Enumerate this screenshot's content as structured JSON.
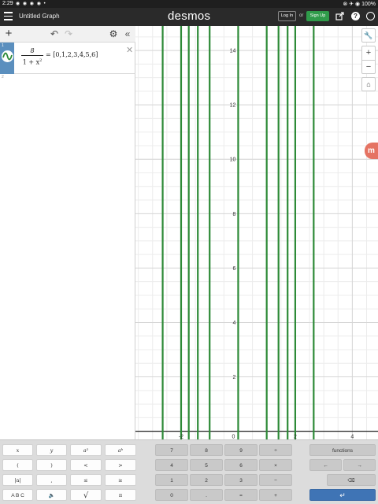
{
  "status_bar": {
    "time": "2:29",
    "notifications": "◉ ◉ ◉ ◉ •",
    "right": "⊗ ✈ ◉ 100%"
  },
  "header": {
    "graph_title": "Untitled Graph",
    "logo": "desmos",
    "login_label": "Log In",
    "or_label": "or",
    "signup_label": "Sign Up",
    "icons": [
      "hamburger-icon",
      "share-icon",
      "help-icon",
      "globe-icon"
    ],
    "help_glyph": "?"
  },
  "expression_panel": {
    "toolbar": {
      "add": "+",
      "undo": "↶",
      "redo": "↷",
      "settings": "⚙",
      "collapse": "«"
    },
    "expressions": [
      {
        "number": "1",
        "numerator": "8",
        "denominator": "1 + x",
        "exponent": "2",
        "rest": "= [0,1,2,3,4,5,6]",
        "close": "✕"
      }
    ],
    "empty_row_number": "2"
  },
  "graph": {
    "x_range": [
      -3.6,
      4.9
    ],
    "y_range": [
      -0.3,
      14.9
    ],
    "x_tick_labels": [
      "-2",
      "0",
      "2",
      "4"
    ],
    "y_tick_labels": [
      "2",
      "4",
      "6",
      "8",
      "10",
      "12",
      "14"
    ],
    "curve_color": "#2d8a37",
    "vertical_lines_x": [
      -2.646,
      -2.0,
      -1.732,
      -1.414,
      -1.0,
      0.0,
      1.0,
      1.414,
      1.732,
      2.0,
      2.646
    ],
    "controls": {
      "wrench": "🔧",
      "zoom_in": "+",
      "zoom_out": "−",
      "home": "⌂"
    },
    "badge": "m"
  },
  "keypad": {
    "rows": [
      [
        "x",
        "y",
        "a²",
        "aᵇ",
        "7",
        "8",
        "9",
        "÷",
        "functions"
      ],
      [
        "(",
        ")",
        "<",
        ">",
        "4",
        "5",
        "6",
        "×",
        "←",
        "→"
      ],
      [
        "|a|",
        ",",
        "≤",
        "≥",
        "1",
        "2",
        "3",
        "−",
        "⌫"
      ],
      [
        "A B C",
        "🔈",
        "√",
        "π",
        "0",
        ".",
        "=",
        "+",
        "↵"
      ]
    ]
  }
}
